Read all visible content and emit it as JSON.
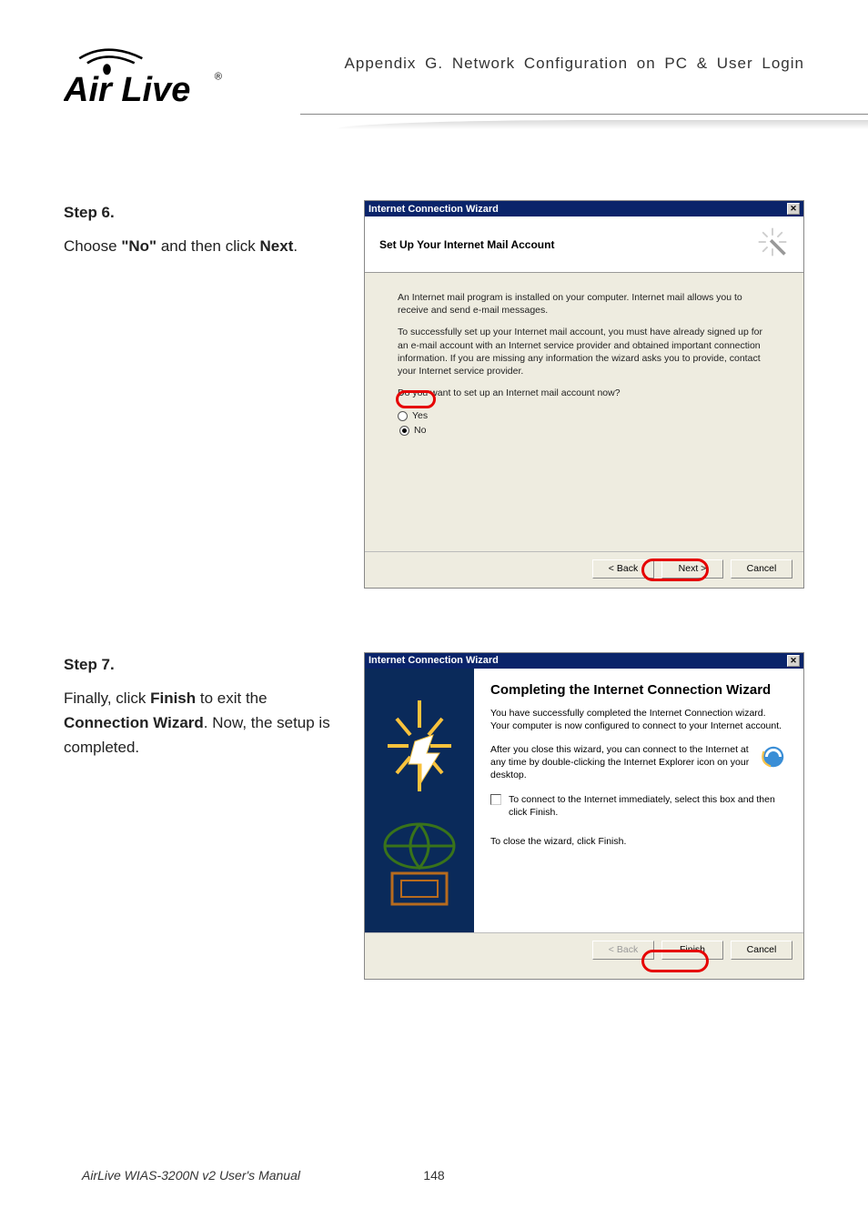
{
  "header": {
    "appendix_title": "Appendix G. Network Configuration on PC & User Login"
  },
  "step6": {
    "label": "Step 6.",
    "text_prefix": "Choose ",
    "bold1": "\"No\"",
    "text_mid": " and then click ",
    "bold2": "Next",
    "text_suffix": "."
  },
  "step7": {
    "label": "Step 7.",
    "text_prefix": "Finally, click ",
    "bold1": "Finish",
    "text_mid1": " to exit the ",
    "bold2": "Connection Wizard",
    "text_suffix": ". Now, the setup is completed."
  },
  "dialog1": {
    "title": "Internet Connection Wizard",
    "header_title": "Set Up Your Internet Mail Account",
    "para1": "An Internet mail program is installed on your computer. Internet mail allows you to receive and send e-mail messages.",
    "para2": "To successfully set up your Internet mail account, you must have already signed up for an e-mail account with an Internet service provider and obtained important connection information. If you are missing any information the wizard asks you to provide, contact your Internet service provider.",
    "question": "Do you want to set up an Internet mail account now?",
    "opt_yes": "Yes",
    "opt_no": "No",
    "btn_back": "< Back",
    "btn_next": "Next >",
    "btn_cancel": "Cancel"
  },
  "dialog2": {
    "title": "Internet Connection Wizard",
    "heading": "Completing the Internet Connection Wizard",
    "para1": "You have successfully completed the Internet Connection wizard. Your computer is now configured to connect to your Internet account.",
    "para2": "After you close this wizard, you can connect to the Internet at any time by double-clicking the Internet Explorer icon on your desktop.",
    "chk_label": "To connect to the Internet immediately, select this box and then click Finish.",
    "para3": "To close the wizard, click Finish.",
    "btn_back": "< Back",
    "btn_finish": "Finish",
    "btn_cancel": "Cancel"
  },
  "footer": {
    "left": "AirLive WIAS-3200N v2 User's Manual",
    "page": "148"
  }
}
